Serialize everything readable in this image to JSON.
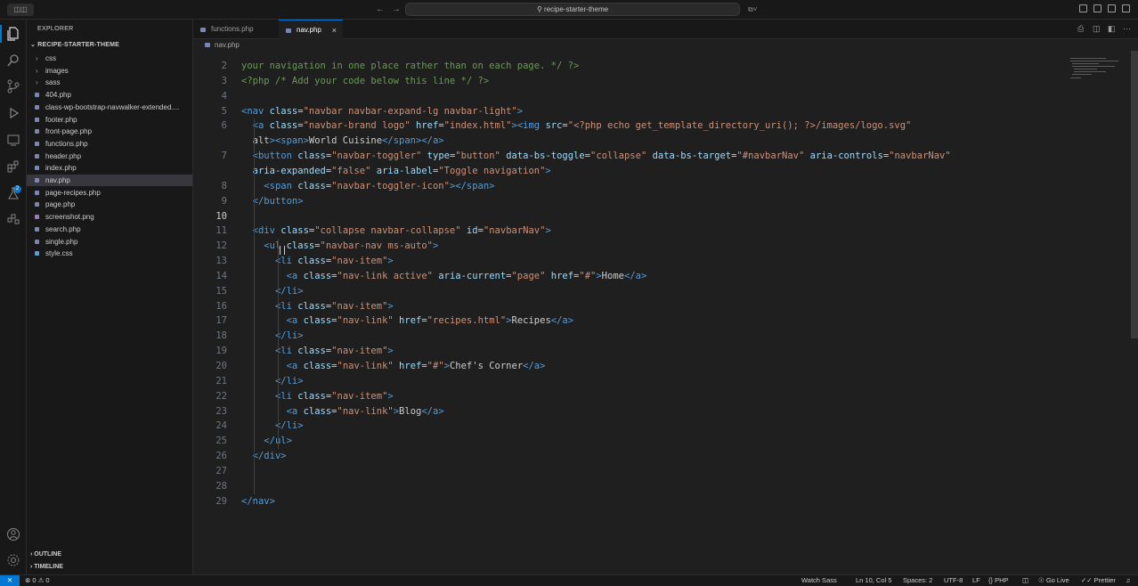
{
  "titlebar": {
    "left_button": "◫◫",
    "back": "←",
    "forward": "→",
    "search_text": "recipe-starter-theme",
    "copilot": "⧉˅"
  },
  "sidebar": {
    "header": "EXPLORER",
    "project": "RECIPE-STARTER-THEME",
    "folders": [
      "css",
      "images",
      "sass"
    ],
    "files": [
      "404.php",
      "class-wp-bootstrap-navwalker-extended....",
      "footer.php",
      "front-page.php",
      "functions.php",
      "header.php",
      "index.php",
      "nav.php",
      "page-recipes.php",
      "page.php",
      "screenshot.png",
      "search.php",
      "single.php",
      "style.css"
    ],
    "selected_file": "nav.php",
    "outline": "OUTLINE",
    "timeline": "TIMELINE",
    "badge": "2"
  },
  "tabs": [
    {
      "label": "functions.php",
      "active": false
    },
    {
      "label": "nav.php",
      "active": true
    }
  ],
  "breadcrumb": "nav.php",
  "editor": {
    "top_partial": "your navigation in one place rather than on each page. */ ?>",
    "current_line": "10",
    "lines": [
      {
        "n": "2",
        "text": ""
      },
      {
        "n": "3",
        "text": "<?php /* Add your code below this line */ ?>"
      },
      {
        "n": "4",
        "text": ""
      },
      {
        "n": "5",
        "text": "<nav class=\"navbar navbar-expand-lg navbar-light\">"
      },
      {
        "n": "6",
        "text": "  <a class=\"navbar-brand logo\" href=\"index.html\"><img src=\"<?php echo get_template_directory_uri(); ?>/images/logo.svg\""
      },
      {
        "n": "",
        "text": "  alt><span>World Cuisine</span></a>"
      },
      {
        "n": "7",
        "text": "  <button class=\"navbar-toggler\" type=\"button\" data-bs-toggle=\"collapse\" data-bs-target=\"#navbarNav\" aria-controls=\"navbarNav\""
      },
      {
        "n": "",
        "text": "  aria-expanded=\"false\" aria-label=\"Toggle navigation\">"
      },
      {
        "n": "8",
        "text": "    <span class=\"navbar-toggler-icon\"></span>"
      },
      {
        "n": "9",
        "text": "  </button>"
      },
      {
        "n": "10",
        "text": ""
      },
      {
        "n": "11",
        "text": "  <div class=\"collapse navbar-collapse\" id=\"navbarNav\">"
      },
      {
        "n": "12",
        "text": "    <ul class=\"navbar-nav ms-auto\">"
      },
      {
        "n": "13",
        "text": "      <li class=\"nav-item\">"
      },
      {
        "n": "14",
        "text": "        <a class=\"nav-link active\" aria-current=\"page\" href=\"#\">Home</a>"
      },
      {
        "n": "15",
        "text": "      </li>"
      },
      {
        "n": "16",
        "text": "      <li class=\"nav-item\">"
      },
      {
        "n": "17",
        "text": "        <a class=\"nav-link\" href=\"recipes.html\">Recipes</a>"
      },
      {
        "n": "18",
        "text": "      </li>"
      },
      {
        "n": "19",
        "text": "      <li class=\"nav-item\">"
      },
      {
        "n": "20",
        "text": "        <a class=\"nav-link\" href=\"#\">Chef's Corner</a>"
      },
      {
        "n": "21",
        "text": "      </li>"
      },
      {
        "n": "22",
        "text": "      <li class=\"nav-item\">"
      },
      {
        "n": "23",
        "text": "        <a class=\"nav-link\">Blog</a>"
      },
      {
        "n": "24",
        "text": "      </li>"
      },
      {
        "n": "25",
        "text": "    </ul>"
      },
      {
        "n": "26",
        "text": "  </div>"
      },
      {
        "n": "27",
        "text": ""
      },
      {
        "n": "28",
        "text": ""
      },
      {
        "n": "29",
        "text": "</nav>"
      }
    ]
  },
  "statusbar": {
    "remote": "⨯",
    "problems": "⊗ 0 ⚠ 0",
    "watch_sass": "Watch Sass",
    "position": "Ln 10, Col 5",
    "spaces": "Spaces: 2",
    "encoding": "UTF-8",
    "eol": "LF",
    "language": "{} PHP",
    "go_live": "Go Live",
    "prettier": "✓✓ Prettier"
  },
  "colors": {
    "accent": "#0078d4",
    "tag": "#569cd6",
    "attribute": "#9cdcfe",
    "string": "#ce9178"
  }
}
